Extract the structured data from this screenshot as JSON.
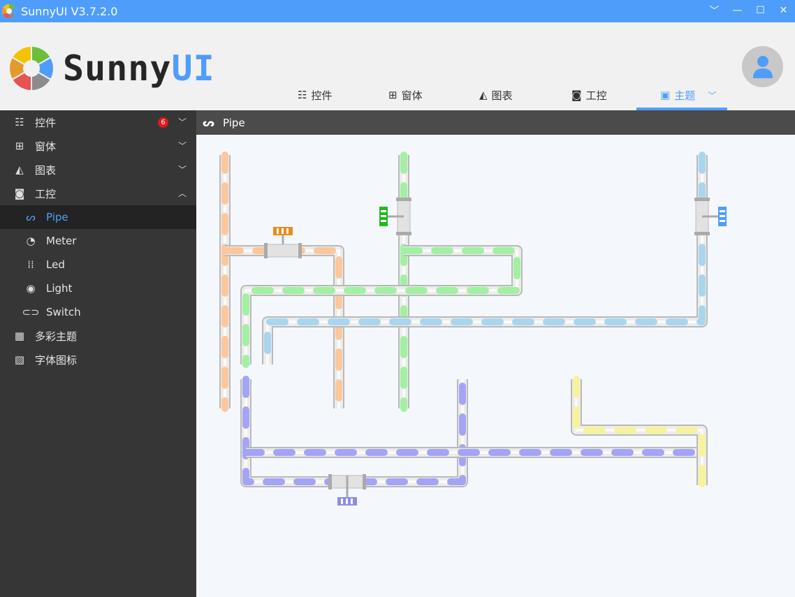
{
  "window": {
    "title": "SunnyUI V3.7.2.0",
    "controls": [
      "﹀",
      "—",
      "☐",
      "✕"
    ]
  },
  "logo": {
    "text_main": "Sunny",
    "text_accent": "UI"
  },
  "tabs": [
    {
      "label": "控件"
    },
    {
      "label": "窗体"
    },
    {
      "label": "图表"
    },
    {
      "label": "工控"
    },
    {
      "label": "主题",
      "active": true
    }
  ],
  "sidebar": {
    "items": [
      {
        "label": "控件",
        "badge": "6"
      },
      {
        "label": "窗体"
      },
      {
        "label": "图表"
      },
      {
        "label": "工控"
      },
      {
        "label": "Pipe"
      },
      {
        "label": "Meter"
      },
      {
        "label": "Led"
      },
      {
        "label": "Light"
      },
      {
        "label": "Switch"
      },
      {
        "label": "多彩主题"
      },
      {
        "label": "字体图标"
      }
    ]
  },
  "content": {
    "title": "Pipe"
  },
  "colors": {
    "accent": "#4f9dfb",
    "orange": "#fcc79c",
    "green": "#a2f0a2",
    "blue": "#a9d6ee",
    "purple": "#a4a4f4",
    "yellow": "#f7f39c",
    "pipe": "#c9c9c9",
    "valve_orange": "#ee8a16",
    "valve_green": "#1fb81f",
    "valve_blue": "#4f9dfb",
    "valve_purple": "#8c8ce8"
  }
}
